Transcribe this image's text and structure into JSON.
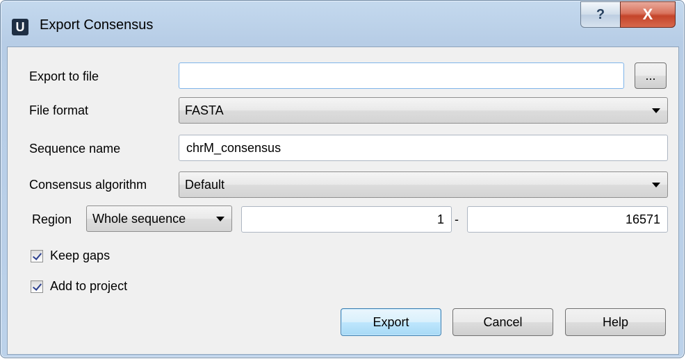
{
  "window": {
    "title": "Export Consensus",
    "app_icon_letter": "U",
    "help_glyph": "?",
    "close_glyph": "X"
  },
  "form": {
    "export_to_file": {
      "label": "Export to file",
      "value": "",
      "browse_label": "..."
    },
    "file_format": {
      "label": "File format",
      "value": "FASTA"
    },
    "sequence_name": {
      "label": "Sequence name",
      "value": "chrM_consensus"
    },
    "consensus_algorithm": {
      "label": "Consensus algorithm",
      "value": "Default"
    },
    "region": {
      "label": "Region",
      "mode": "Whole sequence",
      "start": "1",
      "separator": "-",
      "end": "16571"
    },
    "keep_gaps": {
      "label": "Keep gaps",
      "checked": true
    },
    "add_to_project": {
      "label": "Add to project",
      "checked": true
    }
  },
  "buttons": {
    "export": "Export",
    "cancel": "Cancel",
    "help": "Help"
  },
  "colors": {
    "frame": "#bcd2ea",
    "close_button": "#c4452b",
    "default_button": "#bee6fd",
    "focus_border": "#7eb4ea"
  }
}
